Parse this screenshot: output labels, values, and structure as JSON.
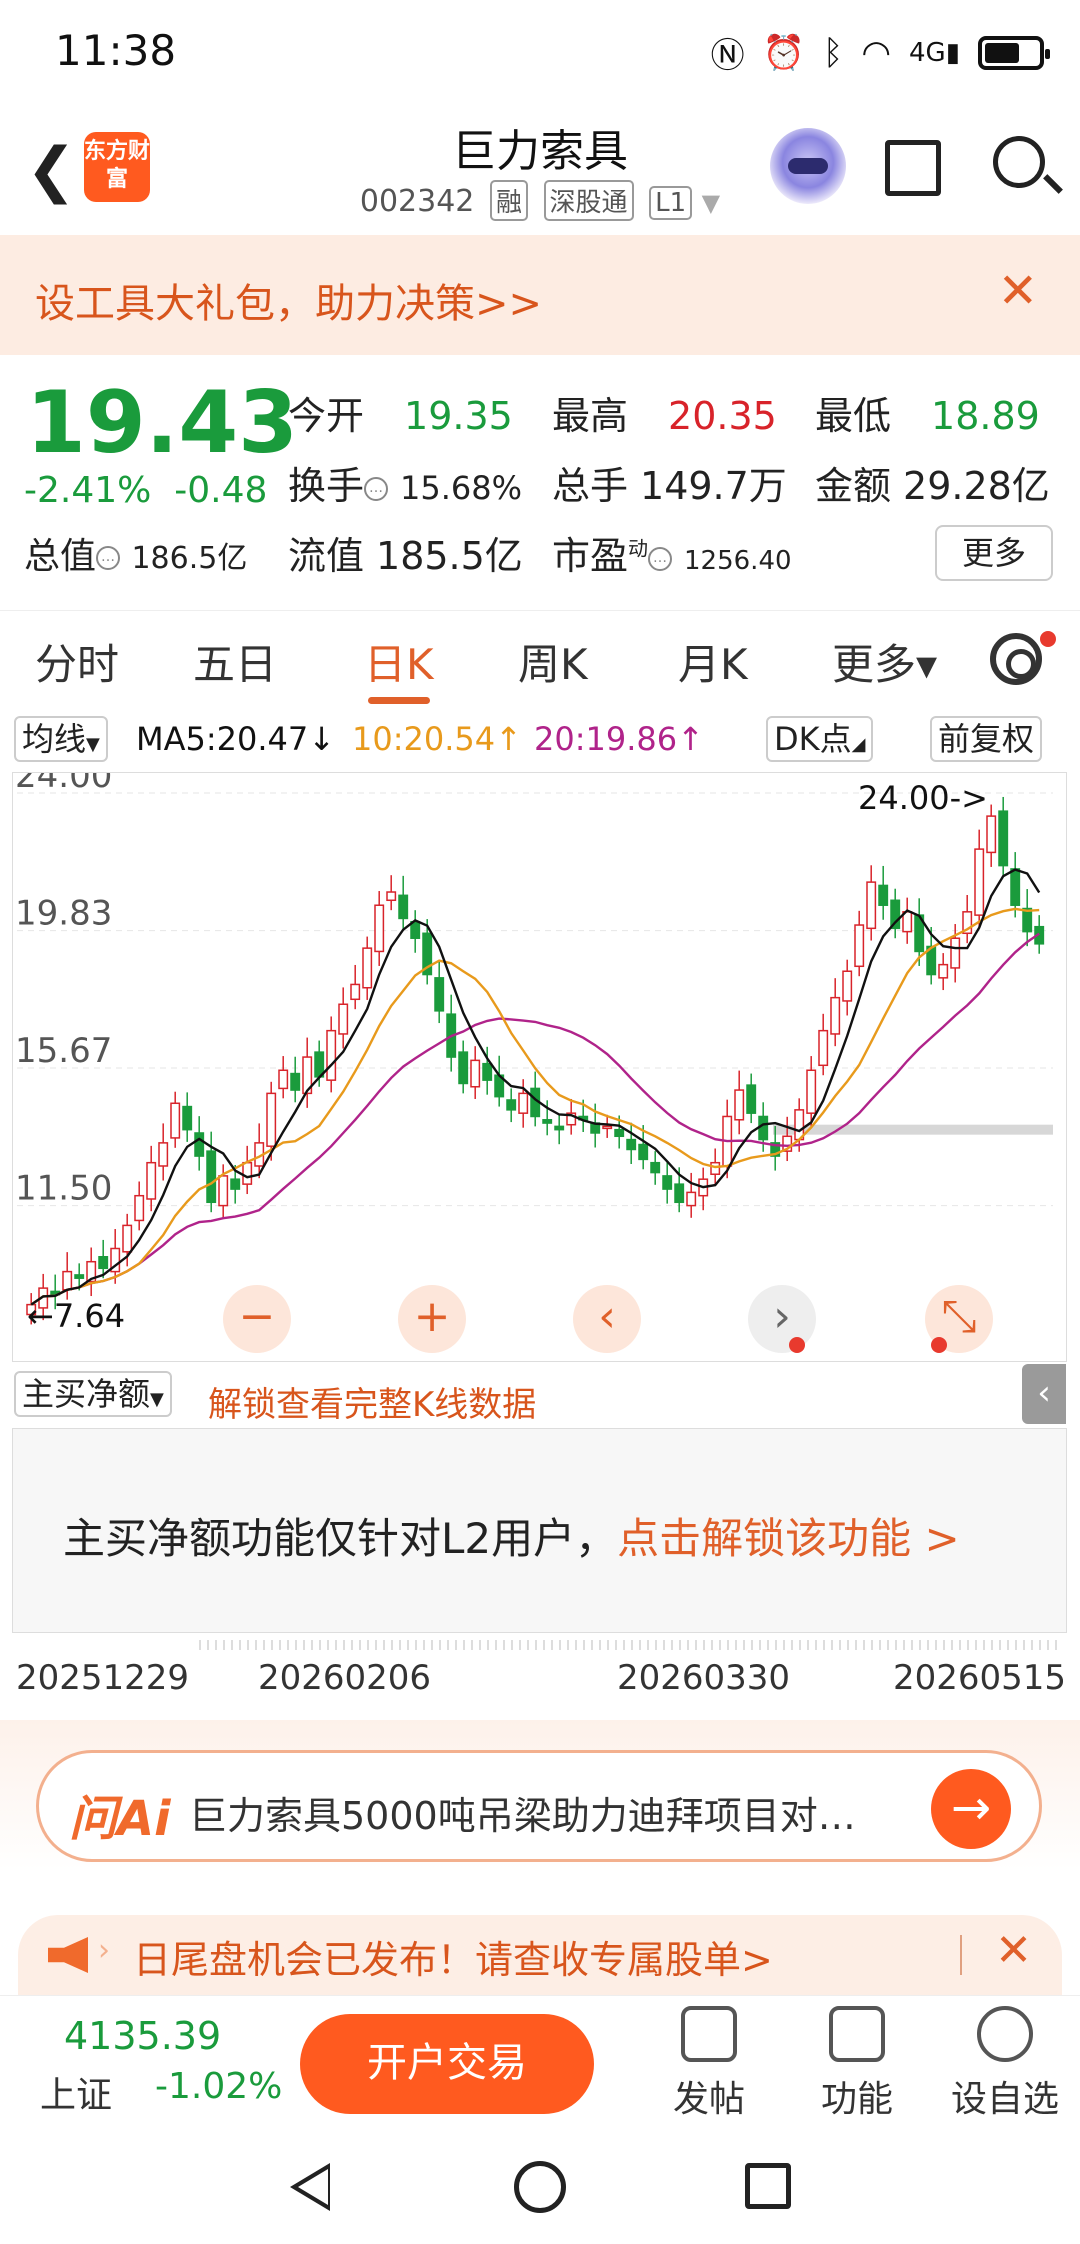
{
  "status": {
    "time": "11:38",
    "icons": [
      "nfc-icon",
      "alarm-icon",
      "bluetooth-icon",
      "wifi-icon",
      "signal-4g-icon",
      "battery-icon"
    ]
  },
  "header": {
    "logo": "东方财富",
    "title": "巨力索具",
    "code": "002342",
    "tags": [
      "融",
      "深股通",
      "L1"
    ]
  },
  "banner": {
    "text": "设工具大礼包，助力决策>>"
  },
  "quote": {
    "price": "19.43",
    "pct": "-2.41%",
    "chg": "-0.48",
    "cap_label": "总值",
    "cap_value": "186.5亿",
    "open_label": "今开",
    "open_value": "19.35",
    "high_label": "最高",
    "high_value": "20.35",
    "low_label": "最低",
    "low_value": "18.89",
    "turnover_label": "换手",
    "turnover_value": "15.68%",
    "volume_label": "总手",
    "volume_value": "149.7万",
    "amount_label": "金额",
    "amount_value": "29.28亿",
    "float_label": "流值",
    "float_value": "185.5亿",
    "pe_label": "市盈",
    "pe_sup": "动",
    "pe_value": "1256.40",
    "more": "更多"
  },
  "tabs": [
    "分时",
    "五日",
    "日K",
    "周K",
    "月K",
    "更多▾"
  ],
  "active_tab": "日K",
  "ma_legend": {
    "select": "均线",
    "ma5": "MA5:20.47↓",
    "ma10": "10:20.54↑",
    "ma20": "20:19.86↑",
    "dk": "DK点",
    "adjust": "前复权",
    "colors": {
      "ma5": "#111111",
      "ma10": "#e89a1c",
      "ma20": "#b0238a"
    }
  },
  "chart_data": {
    "type": "candlestick",
    "y_ticks": [
      "24.00",
      "19.83",
      "15.67",
      "11.50"
    ],
    "ylim": [
      7.64,
      24.0
    ],
    "annotations": {
      "max": "24.00->",
      "min": "←7.64"
    },
    "x_ticks": [
      "20251229",
      "20260206",
      "20260330",
      "20260515"
    ],
    "up_color": "#d8232a",
    "down_color": "#1a9b3c",
    "close": [
      8.5,
      9.0,
      8.8,
      9.5,
      9.3,
      9.8,
      9.6,
      10.2,
      10.9,
      11.8,
      12.8,
      13.4,
      14.6,
      13.8,
      13.0,
      11.6,
      12.4,
      12.0,
      12.8,
      13.4,
      14.9,
      15.6,
      15.0,
      16.0,
      15.4,
      16.8,
      17.6,
      18.2,
      19.3,
      20.6,
      21.0,
      20.2,
      19.6,
      18.5,
      17.4,
      16.0,
      15.2,
      15.9,
      15.3,
      14.8,
      14.4,
      14.9,
      14.2,
      14.0,
      13.8,
      14.3,
      14.1,
      13.7,
      13.9,
      13.6,
      13.2,
      12.9,
      12.5,
      12.0,
      11.6,
      11.9,
      12.3,
      12.8,
      14.2,
      15.0,
      14.3,
      13.5,
      13.0,
      13.6,
      14.4,
      15.6,
      16.8,
      17.8,
      18.6,
      20.0,
      21.3,
      20.6,
      19.9,
      20.4,
      19.2,
      18.5,
      18.8,
      19.6,
      20.4,
      22.3,
      23.3,
      21.8,
      20.6,
      19.8,
      19.43
    ],
    "ma5": [],
    "ma10": [],
    "ma20": [],
    "resistance_level": 13.8
  },
  "controls": [
    "−",
    "+",
    "‹",
    "›",
    "⤡"
  ],
  "indicator": {
    "select": "主买净额",
    "unlock": "解锁查看完整K线数据",
    "msg_plain": "主买净额功能仅针对L2用户，",
    "msg_link": "点击解锁该功能 >"
  },
  "ask_ai": {
    "logo": "问Ai",
    "text": "巨力索具5000吨吊梁助力迪拜项目对…"
  },
  "notice": {
    "text": "日尾盘机会已发布！请查收专属股单>"
  },
  "bottom": {
    "index_value": "4135.39",
    "index_name": "上证",
    "index_chg": "-1.02%",
    "trade": "开户交易",
    "items": [
      "发帖",
      "功能",
      "设自选"
    ]
  }
}
